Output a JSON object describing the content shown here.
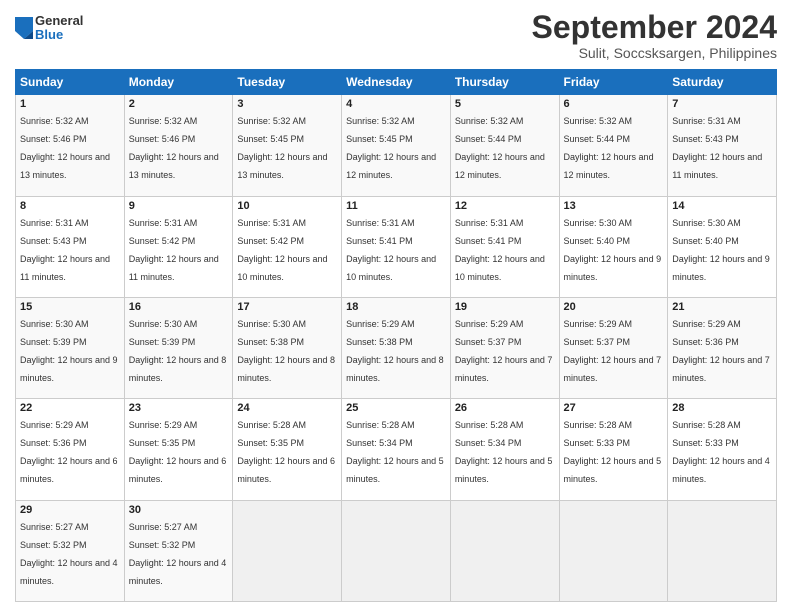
{
  "logo": {
    "general": "General",
    "blue": "Blue"
  },
  "header": {
    "title": "September 2024",
    "subtitle": "Sulit, Soccsksargen, Philippines"
  },
  "columns": [
    "Sunday",
    "Monday",
    "Tuesday",
    "Wednesday",
    "Thursday",
    "Friday",
    "Saturday"
  ],
  "weeks": [
    [
      {
        "day": "1",
        "sunrise": "Sunrise: 5:32 AM",
        "sunset": "Sunset: 5:46 PM",
        "daylight": "Daylight: 12 hours and 13 minutes."
      },
      {
        "day": "2",
        "sunrise": "Sunrise: 5:32 AM",
        "sunset": "Sunset: 5:46 PM",
        "daylight": "Daylight: 12 hours and 13 minutes."
      },
      {
        "day": "3",
        "sunrise": "Sunrise: 5:32 AM",
        "sunset": "Sunset: 5:45 PM",
        "daylight": "Daylight: 12 hours and 13 minutes."
      },
      {
        "day": "4",
        "sunrise": "Sunrise: 5:32 AM",
        "sunset": "Sunset: 5:45 PM",
        "daylight": "Daylight: 12 hours and 12 minutes."
      },
      {
        "day": "5",
        "sunrise": "Sunrise: 5:32 AM",
        "sunset": "Sunset: 5:44 PM",
        "daylight": "Daylight: 12 hours and 12 minutes."
      },
      {
        "day": "6",
        "sunrise": "Sunrise: 5:32 AM",
        "sunset": "Sunset: 5:44 PM",
        "daylight": "Daylight: 12 hours and 12 minutes."
      },
      {
        "day": "7",
        "sunrise": "Sunrise: 5:31 AM",
        "sunset": "Sunset: 5:43 PM",
        "daylight": "Daylight: 12 hours and 11 minutes."
      }
    ],
    [
      {
        "day": "8",
        "sunrise": "Sunrise: 5:31 AM",
        "sunset": "Sunset: 5:43 PM",
        "daylight": "Daylight: 12 hours and 11 minutes."
      },
      {
        "day": "9",
        "sunrise": "Sunrise: 5:31 AM",
        "sunset": "Sunset: 5:42 PM",
        "daylight": "Daylight: 12 hours and 11 minutes."
      },
      {
        "day": "10",
        "sunrise": "Sunrise: 5:31 AM",
        "sunset": "Sunset: 5:42 PM",
        "daylight": "Daylight: 12 hours and 10 minutes."
      },
      {
        "day": "11",
        "sunrise": "Sunrise: 5:31 AM",
        "sunset": "Sunset: 5:41 PM",
        "daylight": "Daylight: 12 hours and 10 minutes."
      },
      {
        "day": "12",
        "sunrise": "Sunrise: 5:31 AM",
        "sunset": "Sunset: 5:41 PM",
        "daylight": "Daylight: 12 hours and 10 minutes."
      },
      {
        "day": "13",
        "sunrise": "Sunrise: 5:30 AM",
        "sunset": "Sunset: 5:40 PM",
        "daylight": "Daylight: 12 hours and 9 minutes."
      },
      {
        "day": "14",
        "sunrise": "Sunrise: 5:30 AM",
        "sunset": "Sunset: 5:40 PM",
        "daylight": "Daylight: 12 hours and 9 minutes."
      }
    ],
    [
      {
        "day": "15",
        "sunrise": "Sunrise: 5:30 AM",
        "sunset": "Sunset: 5:39 PM",
        "daylight": "Daylight: 12 hours and 9 minutes."
      },
      {
        "day": "16",
        "sunrise": "Sunrise: 5:30 AM",
        "sunset": "Sunset: 5:39 PM",
        "daylight": "Daylight: 12 hours and 8 minutes."
      },
      {
        "day": "17",
        "sunrise": "Sunrise: 5:30 AM",
        "sunset": "Sunset: 5:38 PM",
        "daylight": "Daylight: 12 hours and 8 minutes."
      },
      {
        "day": "18",
        "sunrise": "Sunrise: 5:29 AM",
        "sunset": "Sunset: 5:38 PM",
        "daylight": "Daylight: 12 hours and 8 minutes."
      },
      {
        "day": "19",
        "sunrise": "Sunrise: 5:29 AM",
        "sunset": "Sunset: 5:37 PM",
        "daylight": "Daylight: 12 hours and 7 minutes."
      },
      {
        "day": "20",
        "sunrise": "Sunrise: 5:29 AM",
        "sunset": "Sunset: 5:37 PM",
        "daylight": "Daylight: 12 hours and 7 minutes."
      },
      {
        "day": "21",
        "sunrise": "Sunrise: 5:29 AM",
        "sunset": "Sunset: 5:36 PM",
        "daylight": "Daylight: 12 hours and 7 minutes."
      }
    ],
    [
      {
        "day": "22",
        "sunrise": "Sunrise: 5:29 AM",
        "sunset": "Sunset: 5:36 PM",
        "daylight": "Daylight: 12 hours and 6 minutes."
      },
      {
        "day": "23",
        "sunrise": "Sunrise: 5:29 AM",
        "sunset": "Sunset: 5:35 PM",
        "daylight": "Daylight: 12 hours and 6 minutes."
      },
      {
        "day": "24",
        "sunrise": "Sunrise: 5:28 AM",
        "sunset": "Sunset: 5:35 PM",
        "daylight": "Daylight: 12 hours and 6 minutes."
      },
      {
        "day": "25",
        "sunrise": "Sunrise: 5:28 AM",
        "sunset": "Sunset: 5:34 PM",
        "daylight": "Daylight: 12 hours and 5 minutes."
      },
      {
        "day": "26",
        "sunrise": "Sunrise: 5:28 AM",
        "sunset": "Sunset: 5:34 PM",
        "daylight": "Daylight: 12 hours and 5 minutes."
      },
      {
        "day": "27",
        "sunrise": "Sunrise: 5:28 AM",
        "sunset": "Sunset: 5:33 PM",
        "daylight": "Daylight: 12 hours and 5 minutes."
      },
      {
        "day": "28",
        "sunrise": "Sunrise: 5:28 AM",
        "sunset": "Sunset: 5:33 PM",
        "daylight": "Daylight: 12 hours and 4 minutes."
      }
    ],
    [
      {
        "day": "29",
        "sunrise": "Sunrise: 5:27 AM",
        "sunset": "Sunset: 5:32 PM",
        "daylight": "Daylight: 12 hours and 4 minutes."
      },
      {
        "day": "30",
        "sunrise": "Sunrise: 5:27 AM",
        "sunset": "Sunset: 5:32 PM",
        "daylight": "Daylight: 12 hours and 4 minutes."
      },
      null,
      null,
      null,
      null,
      null
    ]
  ]
}
